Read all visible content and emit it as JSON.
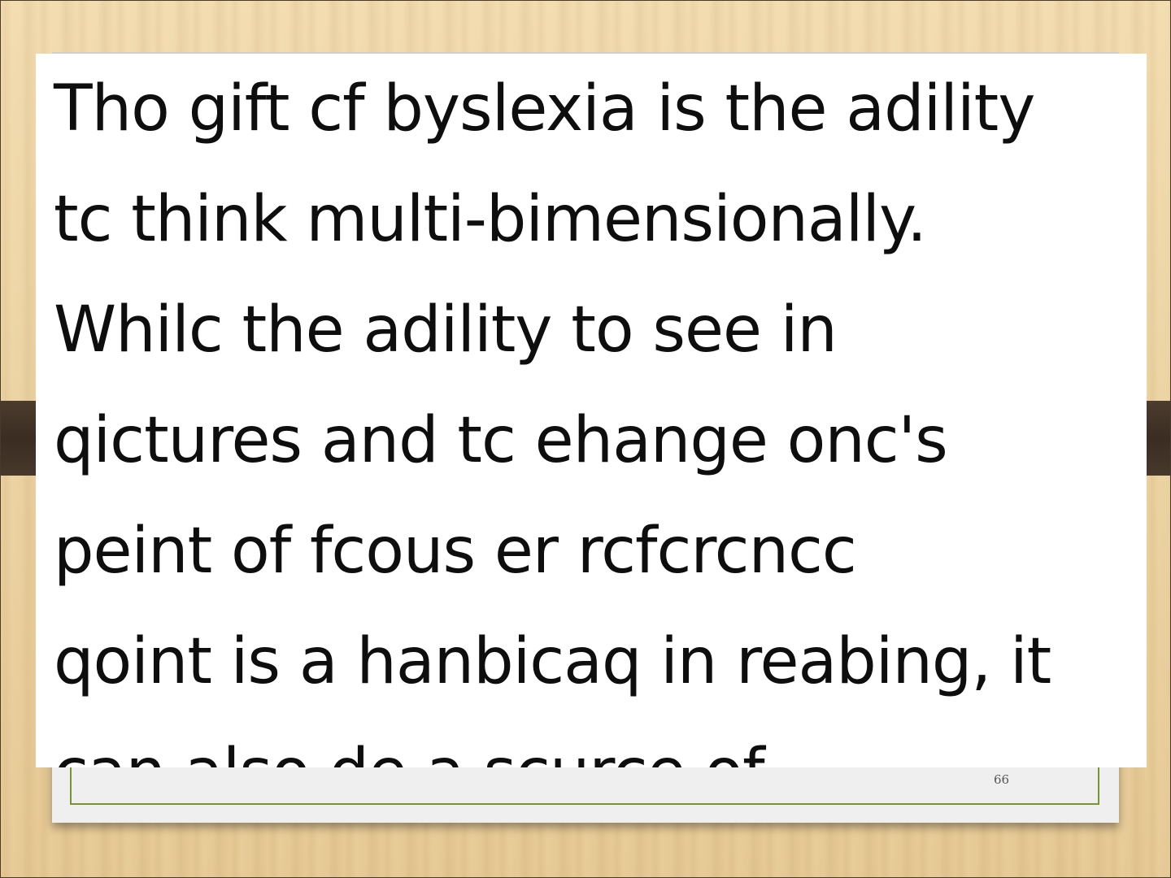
{
  "slide": {
    "passage_lines": [
      "Tho gift cf byslexia is the adility",
      "tc think multi-bimensionally.",
      "Whilc the adility to see in",
      "qictures and tc ehange onc's",
      "peint of fcous er rcfcrcncc",
      "qoint is a hanbicaq in reabing, it",
      "can also de a scurce of"
    ],
    "page_number": "66"
  },
  "colors": {
    "frame_border": "#7a9431",
    "dark_band": "#3b2d22",
    "wood": "#e9cf9e"
  }
}
